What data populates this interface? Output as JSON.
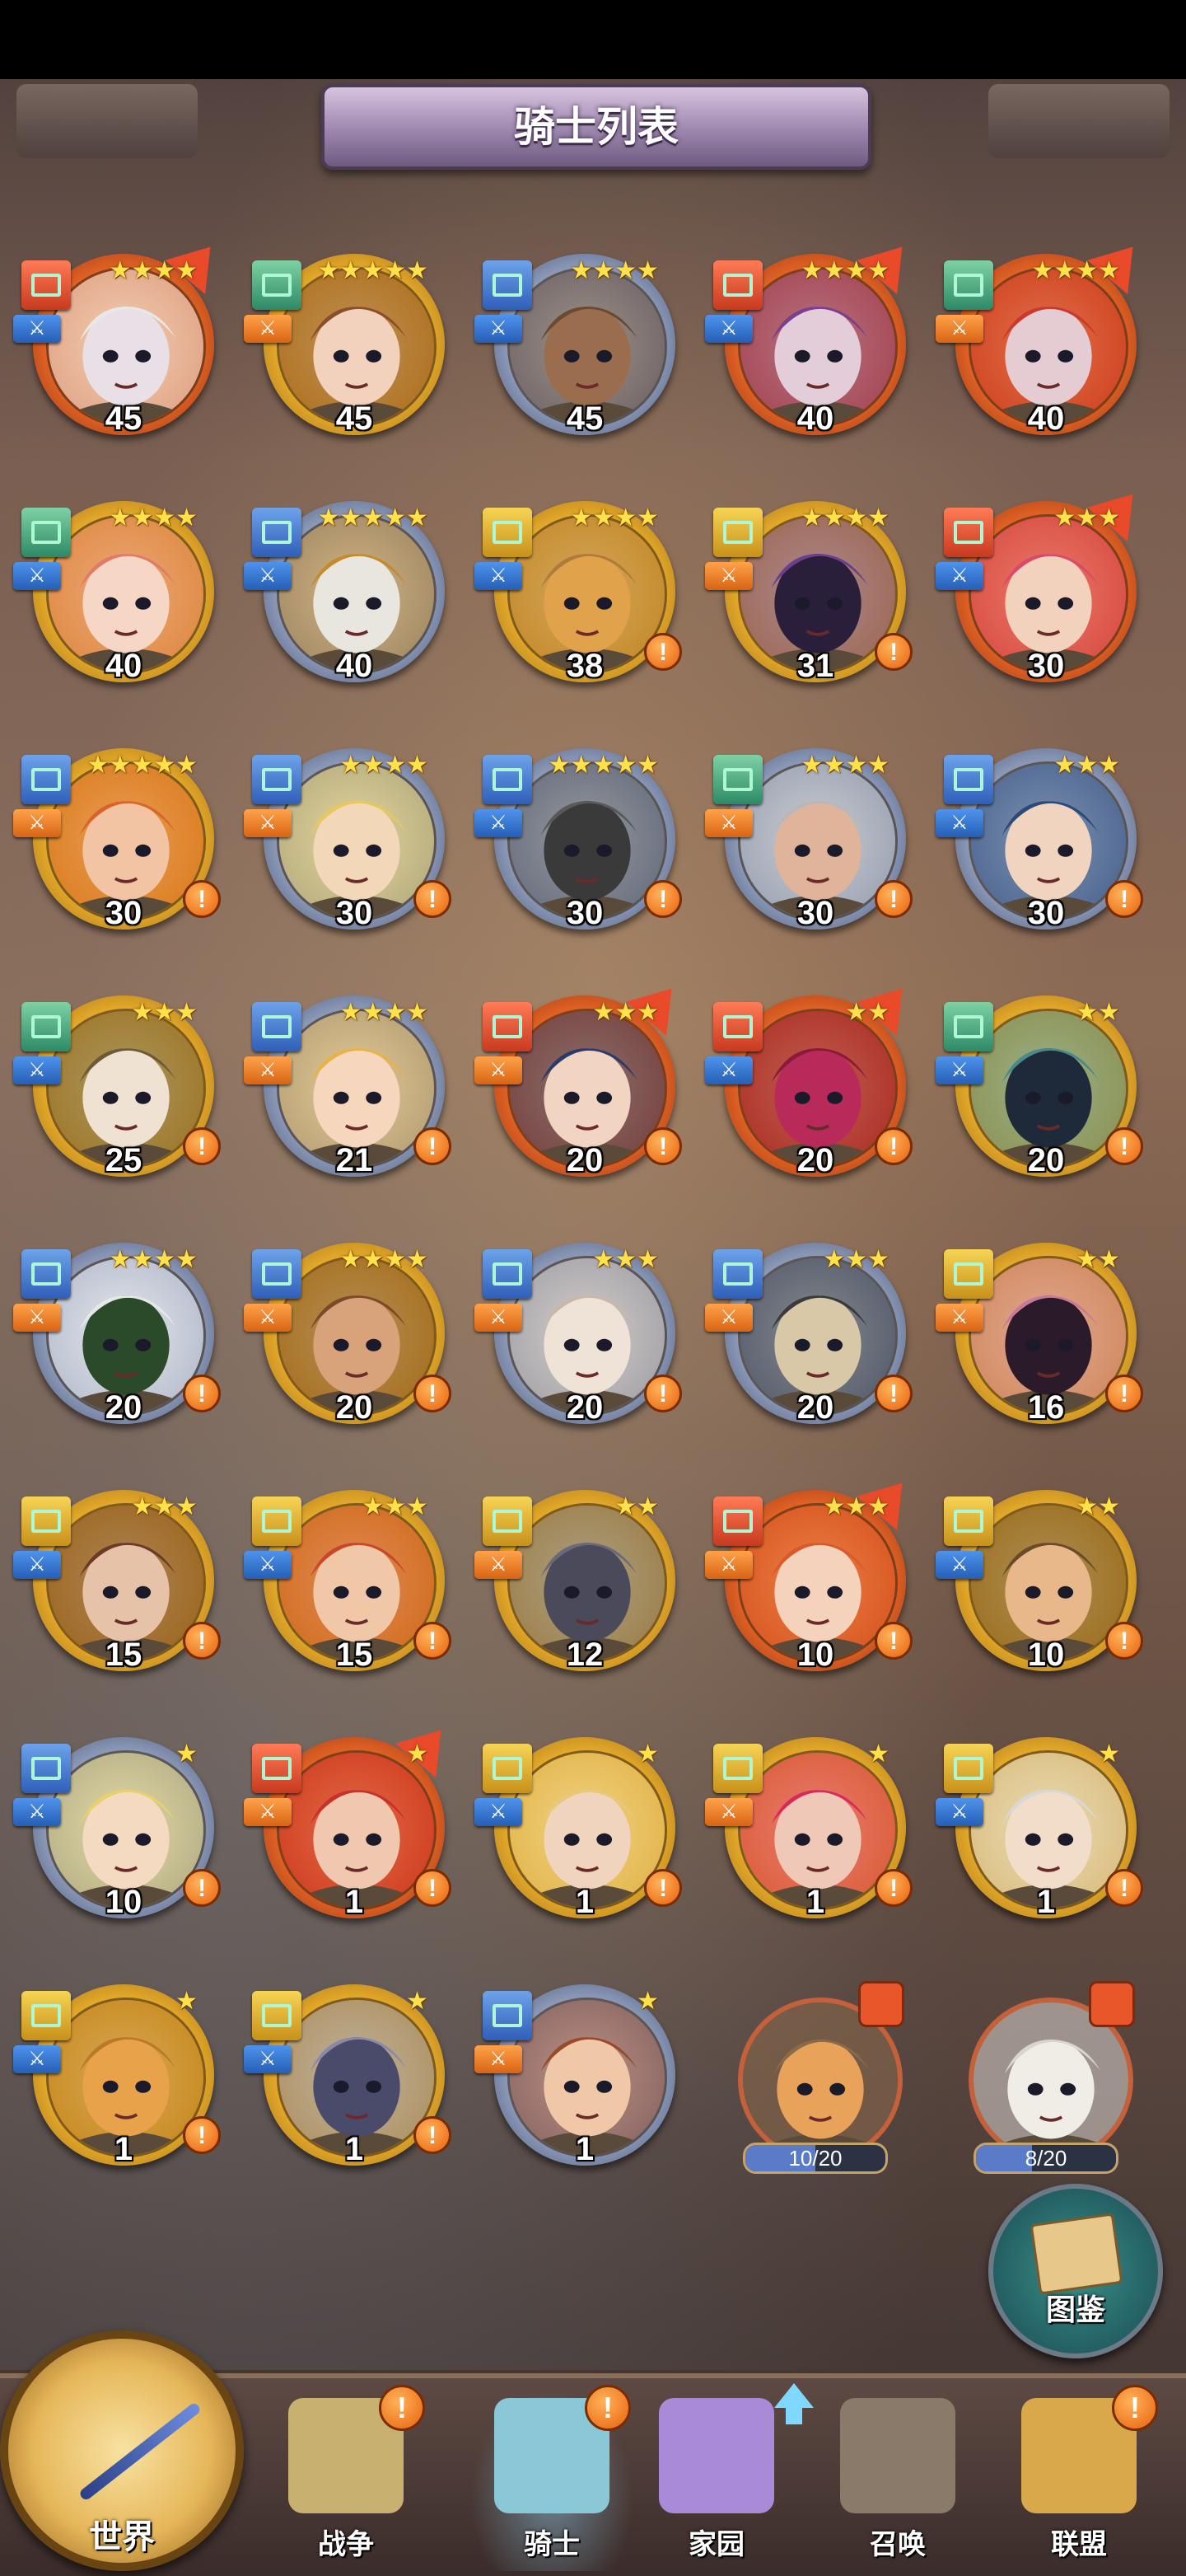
{
  "header": {
    "title": "骑士列表"
  },
  "roster": [
    {
      "level": "45",
      "stars": 4,
      "ring": "orange",
      "badge": "red",
      "role": "blue",
      "upgrade": true,
      "alert": false,
      "skin": "#e8e0e6",
      "hair": "#e8e8e8"
    },
    {
      "level": "45",
      "stars": 5,
      "ring": "gold",
      "badge": "green",
      "role": "orange",
      "upgrade": false,
      "alert": false,
      "skin": "#f2d2bc",
      "hair": "#8a4f2a"
    },
    {
      "level": "45",
      "stars": 4,
      "ring": "silver",
      "badge": "blue",
      "role": "blue",
      "upgrade": false,
      "alert": false,
      "skin": "#9a6d4e",
      "hair": "#6a4a32"
    },
    {
      "level": "40",
      "stars": 4,
      "ring": "orange",
      "badge": "red",
      "role": "blue",
      "upgrade": true,
      "alert": false,
      "skin": "#e2cdd8",
      "hair": "#7b3f8e"
    },
    {
      "level": "40",
      "stars": 4,
      "ring": "orange",
      "badge": "green",
      "role": "orange",
      "upgrade": true,
      "alert": false,
      "skin": "#e4ccd2",
      "hair": "#c83a2e"
    },
    {
      "level": "40",
      "stars": 4,
      "ring": "gold",
      "badge": "green",
      "role": "blue",
      "upgrade": false,
      "alert": false,
      "skin": "#f6d6c4",
      "hair": "#e07a6a"
    },
    {
      "level": "40",
      "stars": 5,
      "ring": "silver",
      "badge": "blue",
      "role": "blue",
      "upgrade": false,
      "alert": false,
      "skin": "#e8e6df",
      "hair": "#c58a2a"
    },
    {
      "level": "38",
      "stars": 4,
      "ring": "gold",
      "badge": "yellow",
      "role": "blue",
      "upgrade": false,
      "alert": true,
      "skin": "#e0a24a",
      "hair": "#b07a3a"
    },
    {
      "level": "31",
      "stars": 4,
      "ring": "gold",
      "badge": "yellow",
      "role": "orange",
      "upgrade": false,
      "alert": true,
      "skin": "#2a1f3a",
      "hair": "#6a3f8e"
    },
    {
      "level": "30",
      "stars": 3,
      "ring": "orange",
      "badge": "red",
      "role": "blue",
      "upgrade": true,
      "alert": false,
      "skin": "#f2d2bc",
      "hair": "#d84a6a"
    },
    {
      "level": "30",
      "stars": 5,
      "ring": "gold",
      "badge": "blue",
      "role": "orange",
      "upgrade": false,
      "alert": true,
      "skin": "#f3c4a4",
      "hair": "#d8642a"
    },
    {
      "level": "30",
      "stars": 4,
      "ring": "silver",
      "badge": "blue",
      "role": "orange",
      "upgrade": false,
      "alert": true,
      "skin": "#f2d8b8",
      "hair": "#e8c85a"
    },
    {
      "level": "30",
      "stars": 5,
      "ring": "silver",
      "badge": "blue",
      "role": "blue",
      "upgrade": false,
      "alert": true,
      "skin": "#3a3a3a",
      "hair": "#5a5a5a"
    },
    {
      "level": "30",
      "stars": 4,
      "ring": "silver",
      "badge": "green",
      "role": "orange",
      "upgrade": false,
      "alert": true,
      "skin": "#e0b49a",
      "hair": "#b8b8b8"
    },
    {
      "level": "30",
      "stars": 3,
      "ring": "silver",
      "badge": "blue",
      "role": "blue",
      "upgrade": false,
      "alert": true,
      "skin": "#f0d4c0",
      "hair": "#2a4a7a"
    },
    {
      "level": "25",
      "stars": 3,
      "ring": "gold",
      "badge": "green",
      "role": "blue",
      "upgrade": false,
      "alert": true,
      "skin": "#f0e2d2",
      "hair": "#6a5a3a"
    },
    {
      "level": "21",
      "stars": 4,
      "ring": "silver",
      "badge": "blue",
      "role": "orange",
      "upgrade": false,
      "alert": true,
      "skin": "#f6d6bc",
      "hair": "#e8b24a"
    },
    {
      "level": "20",
      "stars": 3,
      "ring": "orange",
      "badge": "red",
      "role": "orange",
      "upgrade": true,
      "alert": true,
      "skin": "#f2d4c2",
      "hair": "#2a3a6a"
    },
    {
      "level": "20",
      "stars": 2,
      "ring": "orange",
      "badge": "red",
      "role": "blue",
      "upgrade": true,
      "alert": true,
      "skin": "#b82a5a",
      "hair": "#8a1a3a"
    },
    {
      "level": "20",
      "stars": 2,
      "ring": "gold",
      "badge": "green",
      "role": "blue",
      "upgrade": false,
      "alert": true,
      "skin": "#1e2a3a",
      "hair": "#4a8a8a"
    },
    {
      "level": "20",
      "stars": 4,
      "ring": "silver",
      "badge": "blue",
      "role": "orange",
      "upgrade": false,
      "alert": true,
      "skin": "#2a4a2a",
      "hair": "#e8e8e8"
    },
    {
      "level": "20",
      "stars": 4,
      "ring": "gold",
      "badge": "blue",
      "role": "orange",
      "upgrade": false,
      "alert": true,
      "skin": "#d8a27a",
      "hair": "#7a4a2a"
    },
    {
      "level": "20",
      "stars": 3,
      "ring": "silver",
      "badge": "blue",
      "role": "orange",
      "upgrade": false,
      "alert": true,
      "skin": "#efe2d6",
      "hair": "#c8b8a8"
    },
    {
      "level": "20",
      "stars": 3,
      "ring": "silver",
      "badge": "blue",
      "role": "orange",
      "upgrade": false,
      "alert": true,
      "skin": "#d8c8a8",
      "hair": "#3a3a3a"
    },
    {
      "level": "16",
      "stars": 2,
      "ring": "gold",
      "badge": "yellow",
      "role": "orange",
      "upgrade": false,
      "alert": true,
      "skin": "#2a1a2a",
      "hair": "#c87a9a"
    },
    {
      "level": "15",
      "stars": 3,
      "ring": "gold",
      "badge": "yellow",
      "role": "blue",
      "upgrade": false,
      "alert": true,
      "skin": "#e6c2a8",
      "hair": "#6a3a2a"
    },
    {
      "level": "15",
      "stars": 3,
      "ring": "gold",
      "badge": "yellow",
      "role": "blue",
      "upgrade": false,
      "alert": true,
      "skin": "#f0c8a8",
      "hair": "#c8462a"
    },
    {
      "level": "12",
      "stars": 2,
      "ring": "gold",
      "badge": "yellow",
      "role": "orange",
      "upgrade": false,
      "alert": false,
      "skin": "#4a4a5a",
      "hair": "#6a6a7a"
    },
    {
      "level": "10",
      "stars": 3,
      "ring": "orange",
      "badge": "red",
      "role": "orange",
      "upgrade": true,
      "alert": true,
      "skin": "#f4d2bc",
      "hair": "#d85a2a"
    },
    {
      "level": "10",
      "stars": 2,
      "ring": "gold",
      "badge": "yellow",
      "role": "blue",
      "upgrade": false,
      "alert": true,
      "skin": "#e8b88a",
      "hair": "#6a4a2a"
    },
    {
      "level": "10",
      "stars": 1,
      "ring": "silver",
      "badge": "blue",
      "role": "blue",
      "upgrade": false,
      "alert": true,
      "skin": "#f4dac0",
      "hair": "#e8d06a"
    },
    {
      "level": "1",
      "stars": 1,
      "ring": "orange",
      "badge": "red",
      "role": "orange",
      "upgrade": true,
      "alert": true,
      "skin": "#f0c8b0",
      "hair": "#c8302a"
    },
    {
      "level": "1",
      "stars": 1,
      "ring": "gold",
      "badge": "yellow",
      "role": "blue",
      "upgrade": false,
      "alert": true,
      "skin": "#f0d4be",
      "hair": "#e8c87a"
    },
    {
      "level": "1",
      "stars": 1,
      "ring": "gold",
      "badge": "yellow",
      "role": "orange",
      "upgrade": false,
      "alert": true,
      "skin": "#f0c8b8",
      "hair": "#d82a5a"
    },
    {
      "level": "1",
      "stars": 1,
      "ring": "gold",
      "badge": "yellow",
      "role": "blue",
      "upgrade": false,
      "alert": true,
      "skin": "#f2dcca",
      "hair": "#d8d8d8"
    },
    {
      "level": "1",
      "stars": 1,
      "ring": "gold",
      "badge": "yellow",
      "role": "blue",
      "upgrade": false,
      "alert": true,
      "skin": "#e8a24a",
      "hair": "#b87a2a"
    },
    {
      "level": "1",
      "stars": 1,
      "ring": "gold",
      "badge": "yellow",
      "role": "blue",
      "upgrade": false,
      "alert": true,
      "skin": "#4a4a6a",
      "hair": "#8a8aa8"
    },
    {
      "level": "1",
      "stars": 1,
      "ring": "silver",
      "badge": "blue",
      "role": "orange",
      "upgrade": false,
      "alert": false,
      "skin": "#f0c8a8",
      "hair": "#9a4a2a"
    }
  ],
  "fragments": [
    {
      "progress": "10/20",
      "fraction": 0.5,
      "skin": "#e8a25a",
      "hair": "#8a6a4a"
    },
    {
      "progress": "8/20",
      "fraction": 0.4,
      "skin": "#f0ece6",
      "hair": "#d8d4ce"
    }
  ],
  "codex": {
    "label": "图鉴"
  },
  "nav": {
    "world": "世界",
    "items": [
      {
        "label": "战争",
        "alert": "!",
        "icon": "map-icon",
        "color": "#c8b070"
      },
      {
        "label": "骑士",
        "alert": "!",
        "icon": "knight-icon",
        "color": "#8ac8d8",
        "active": true
      },
      {
        "label": "家园",
        "alert": "",
        "icon": "house-icon",
        "color": "#a88ad8"
      },
      {
        "label": "召唤",
        "alert": "",
        "icon": "train-icon",
        "color": "#8a7a6a"
      },
      {
        "label": "联盟",
        "alert": "!",
        "icon": "castle-icon",
        "color": "#d8a84a"
      }
    ]
  }
}
